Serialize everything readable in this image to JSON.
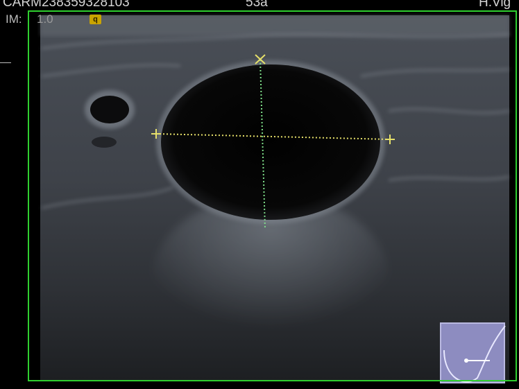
{
  "header": {
    "patient_id": "CARM238359328103",
    "age": "53a",
    "operator": "H.Vig"
  },
  "overlay": {
    "im_label": "IM:",
    "im_value": "1.0",
    "badge_icon": "probe-marker-icon",
    "badge_glyph": "q"
  },
  "colors": {
    "frame": "#2fcf2f",
    "caliper_h": "#e6e06a",
    "caliper_v": "#7fe08a",
    "badge": "#c9a400"
  },
  "body_marker_icon": "breast-body-marker-icon"
}
